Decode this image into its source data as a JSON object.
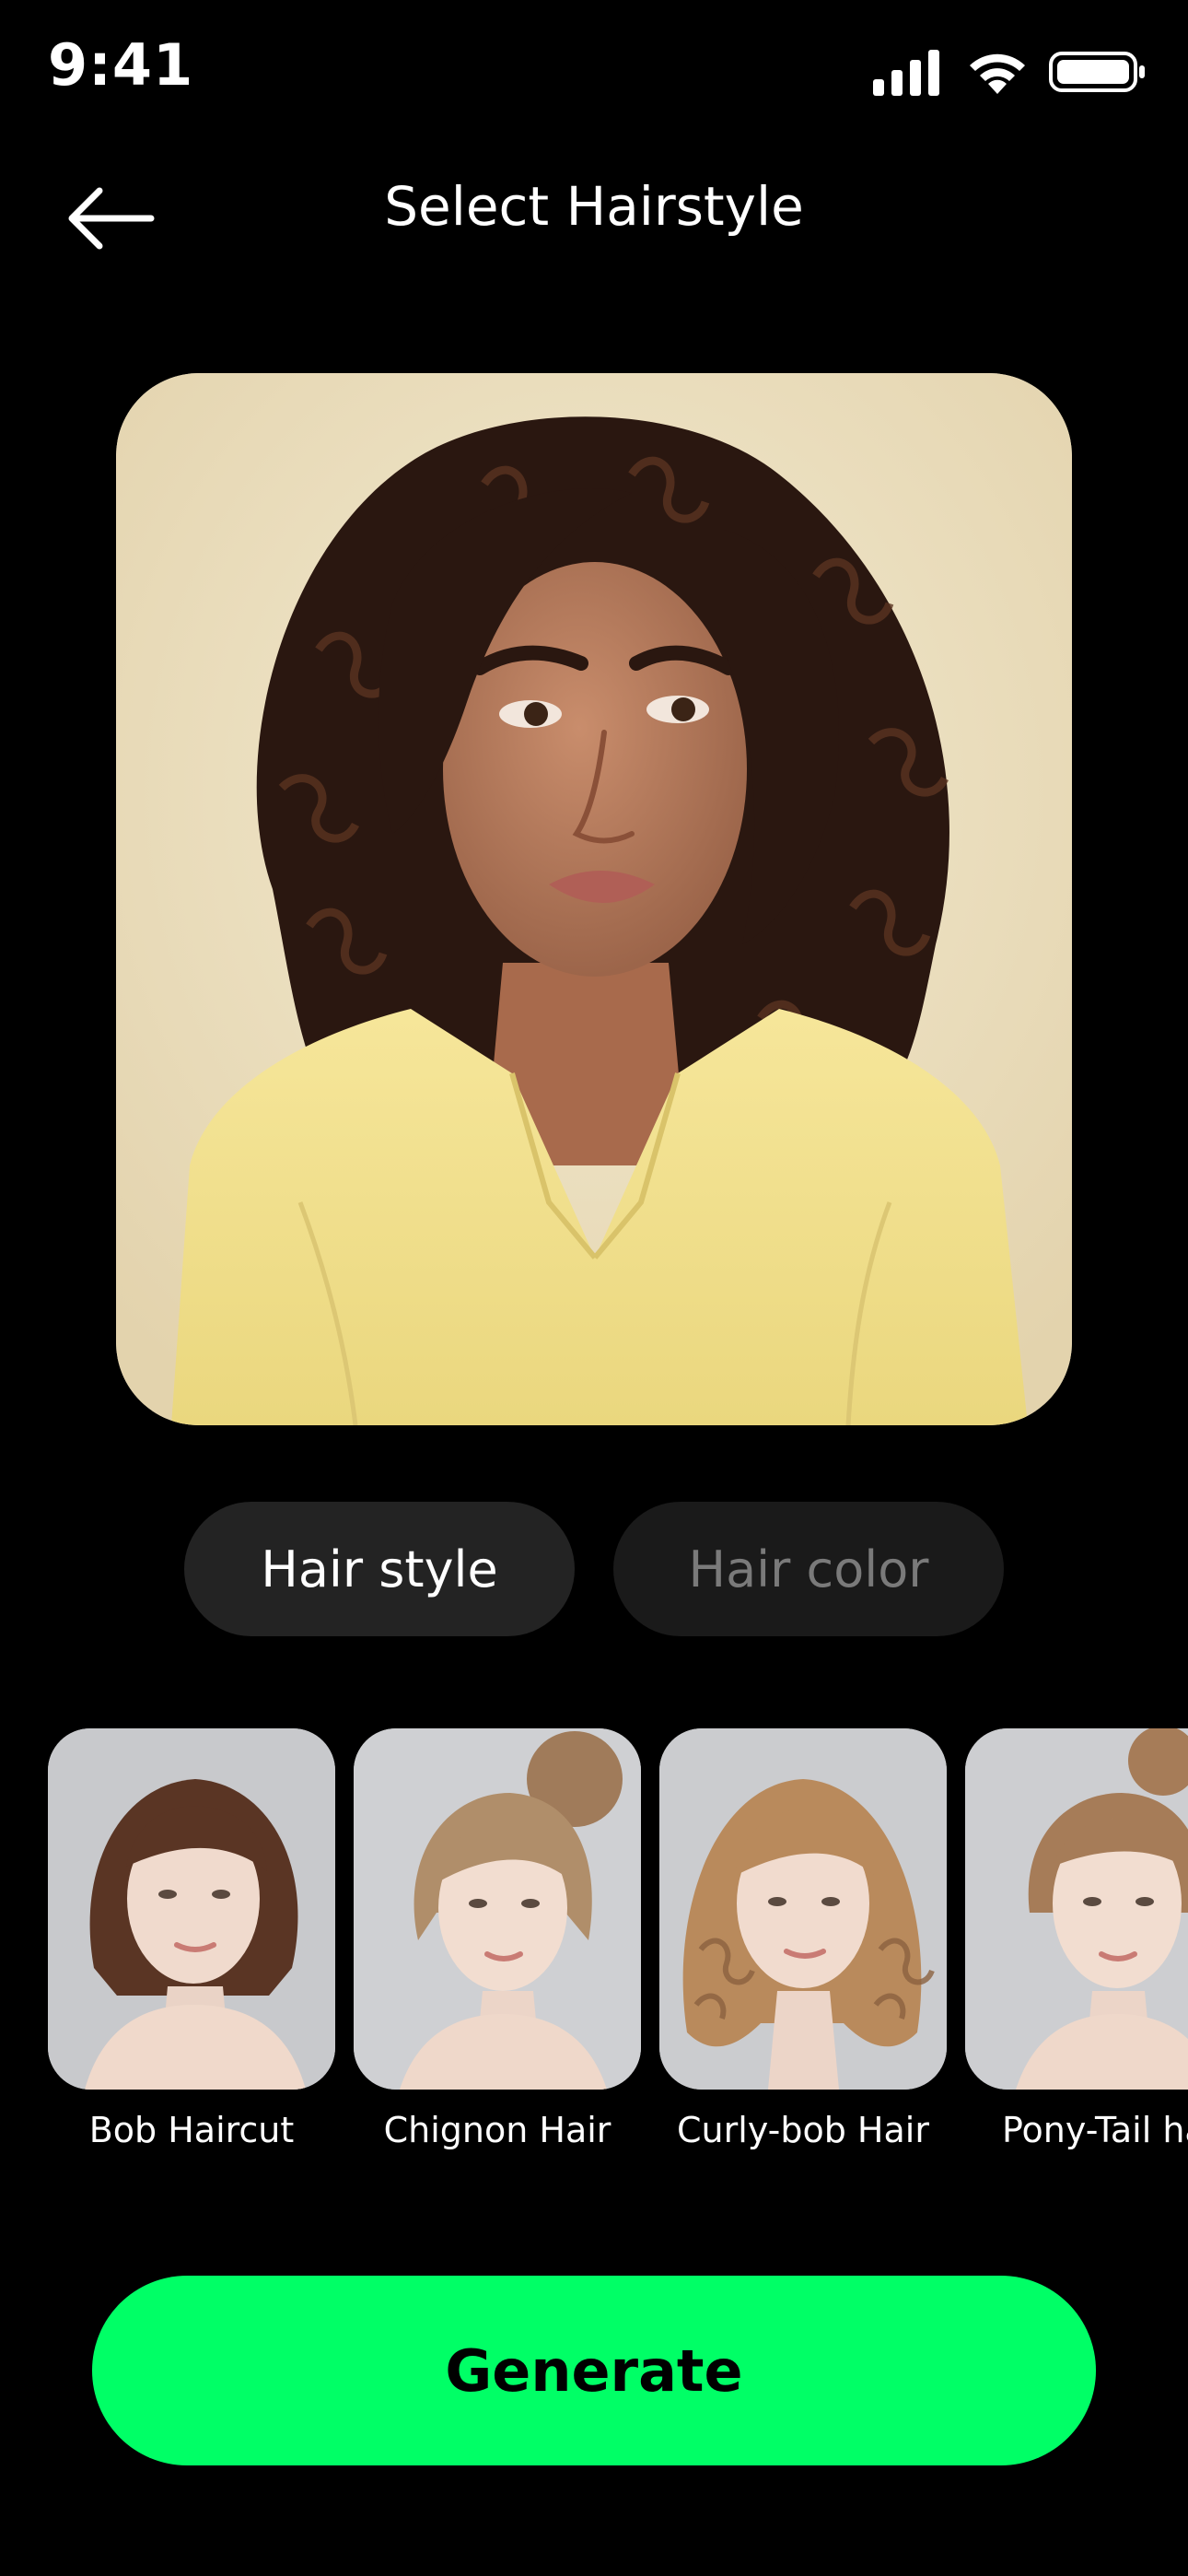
{
  "status_bar": {
    "time": "9:41",
    "icons": [
      "signal-icon",
      "wifi-icon",
      "battery-icon"
    ]
  },
  "header": {
    "back_icon": "arrow-left-icon",
    "title": "Select Hairstyle"
  },
  "tabs": [
    {
      "label": "Hair style",
      "selected": true
    },
    {
      "label": "Hair color",
      "selected": false
    }
  ],
  "hairstyles": [
    {
      "label": "Bob Haircut"
    },
    {
      "label": "Chignon Hair"
    },
    {
      "label": "Curly-bob Hair"
    },
    {
      "label": "Pony-Tail ha"
    }
  ],
  "generate_button": {
    "label": "Generate"
  },
  "colors": {
    "background": "#000000",
    "accent": "#00ff66",
    "tab_background": "#1e1e1e",
    "tab_inactive_text": "#7a7a7a"
  }
}
